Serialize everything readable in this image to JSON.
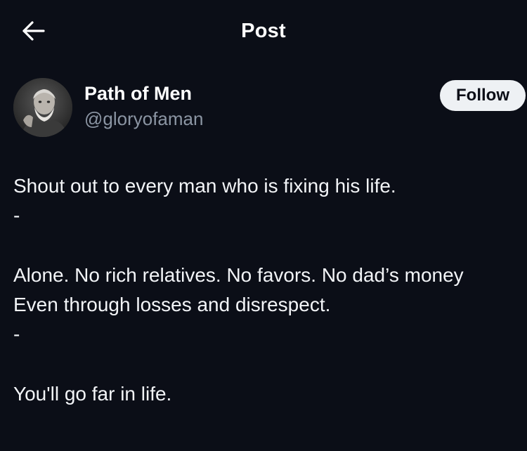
{
  "header": {
    "title": "Post",
    "back_icon": "arrow-left-icon"
  },
  "author": {
    "display_name": "Path of Men",
    "handle": "@gloryofaman",
    "follow_label": "Follow"
  },
  "post": {
    "lines": [
      "Shout out to every man who is fixing his life.",
      "-",
      "Alone. No rich relatives. No favors. No dad’s money",
      "Even through losses and disrespect.",
      "-",
      "You'll go far in life."
    ]
  },
  "colors": {
    "background": "#0b0e17",
    "text": "#ffffff",
    "secondary_text": "#8b95a3",
    "follow_button_bg": "#eef1f4"
  }
}
